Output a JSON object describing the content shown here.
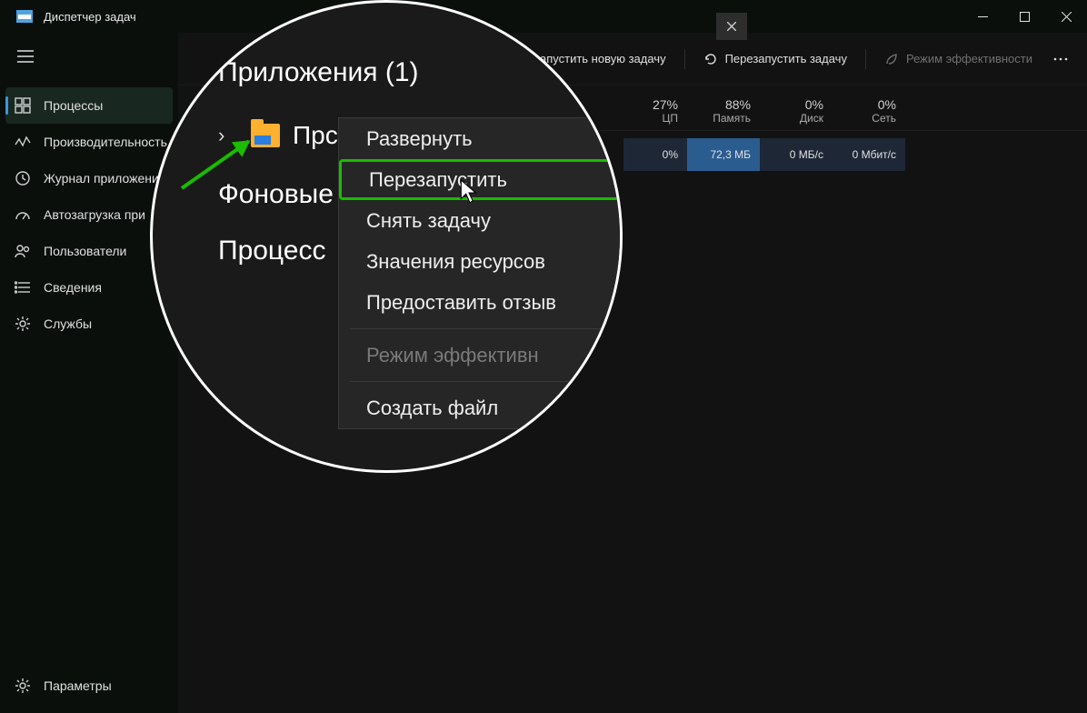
{
  "app": {
    "title": "Диспетчер задач"
  },
  "sidebar": {
    "items": [
      {
        "label": "Процессы"
      },
      {
        "label": "Производительность"
      },
      {
        "label": "Журнал приложени"
      },
      {
        "label": "Автозагрузка при"
      },
      {
        "label": "Пользователи"
      },
      {
        "label": "Сведения"
      },
      {
        "label": "Службы"
      }
    ],
    "footer": {
      "label": "Параметры"
    }
  },
  "toolbar": {
    "new_task": "апустить новую задачу",
    "restart_task": "Перезапустить задачу",
    "efficiency": "Режим эффективности"
  },
  "columns": {
    "cpu": {
      "pct": "27%",
      "label": "ЦП"
    },
    "mem": {
      "pct": "88%",
      "label": "Память"
    },
    "disk": {
      "pct": "0%",
      "label": "Диск"
    },
    "net": {
      "pct": "0%",
      "label": "Сеть"
    }
  },
  "row": {
    "cpu": "0%",
    "mem": "72,3 МБ",
    "disk": "0 МБ/с",
    "net": "0 Мбит/с"
  },
  "magnifier": {
    "apps_heading": "Приложения (1)",
    "process_trunc": "Прс",
    "bg_heading": "Фоновые",
    "proc_heading": "Процесс",
    "context": {
      "expand": "Развернуть",
      "restart": "Перезапустить",
      "end": "Снять задачу",
      "values": "Значения ресурсов",
      "feedback": "Предоставить отзыв",
      "efficiency": "Режим эффективн",
      "dump": "Создать файл "
    }
  }
}
